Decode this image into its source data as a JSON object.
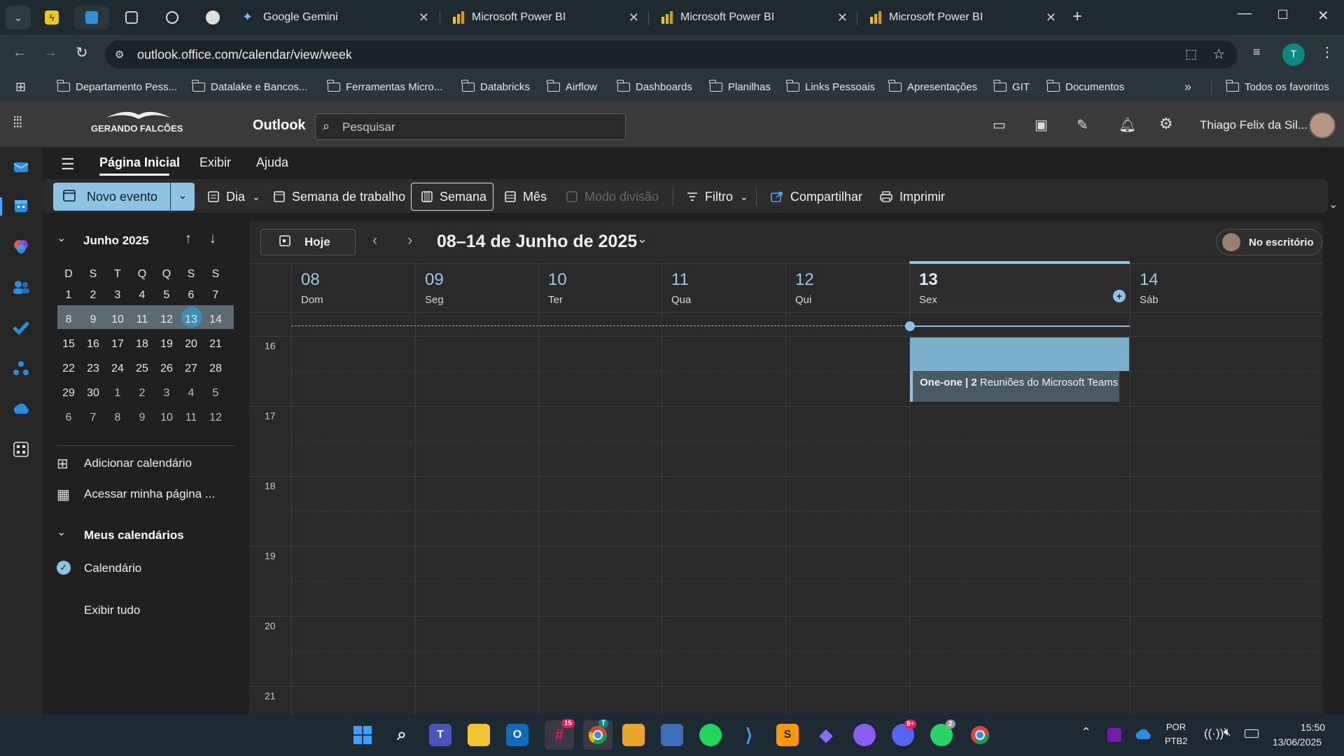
{
  "browser": {
    "tabs": [
      {
        "title": "Google Gemini",
        "icon": "gemini-icon"
      },
      {
        "title": "Microsoft Power BI",
        "icon": "powerbi-icon"
      },
      {
        "title": "Microsoft Power BI",
        "icon": "powerbi-icon"
      },
      {
        "title": "Microsoft Power BI",
        "icon": "powerbi-icon"
      }
    ],
    "url": "outlook.office.com/calendar/view/week",
    "profile_initial": "T",
    "bookmarks": [
      "Departamento Pess...",
      "Datalake e Bancos...",
      "Ferramentas Micro...",
      "Databricks",
      "Airflow",
      "Dashboards",
      "Planilhas",
      "Links Pessoais",
      "Apresentações",
      "GIT",
      "Documentos"
    ],
    "all_bookmarks": "Todos os favoritos"
  },
  "outlook": {
    "org_logo_text": "GERANDO FALCÕES",
    "app_name": "Outlook",
    "search_placeholder": "Pesquisar",
    "user_name": "Thiago Felix da Sil..."
  },
  "ribbon": {
    "tabs": [
      "Página Inicial",
      "Exibir",
      "Ajuda"
    ],
    "new_event": "Novo evento",
    "day": "Dia",
    "work_week": "Semana de trabalho",
    "week": "Semana",
    "month": "Mês",
    "split": "Modo divisão",
    "filter": "Filtro",
    "share": "Compartilhar",
    "print": "Imprimir"
  },
  "mini_calendar": {
    "month_label": "Junho 2025",
    "weekdays": [
      "D",
      "S",
      "T",
      "Q",
      "Q",
      "S",
      "S"
    ],
    "weeks": [
      [
        "1",
        "2",
        "3",
        "4",
        "5",
        "6",
        "7"
      ],
      [
        "8",
        "9",
        "10",
        "11",
        "12",
        "13",
        "14"
      ],
      [
        "15",
        "16",
        "17",
        "18",
        "19",
        "20",
        "21"
      ],
      [
        "22",
        "23",
        "24",
        "25",
        "26",
        "27",
        "28"
      ],
      [
        "29",
        "30",
        "1",
        "2",
        "3",
        "4",
        "5"
      ],
      [
        "6",
        "7",
        "8",
        "9",
        "10",
        "11",
        "12"
      ]
    ],
    "today": "13"
  },
  "sidebar": {
    "add_calendar": "Adicionar calendário",
    "my_page": "Acessar minha página ...",
    "my_calendars": "Meus calendários",
    "calendar": "Calendário",
    "show_all": "Exibir tudo"
  },
  "calendar": {
    "today_button": "Hoje",
    "range_title": "08–14 de Junho de 2025",
    "status": "No escritório",
    "days": [
      {
        "num": "08",
        "name": "Dom"
      },
      {
        "num": "09",
        "name": "Seg"
      },
      {
        "num": "10",
        "name": "Ter"
      },
      {
        "num": "11",
        "name": "Qua"
      },
      {
        "num": "12",
        "name": "Qui"
      },
      {
        "num": "13",
        "name": "Sex"
      },
      {
        "num": "14",
        "name": "Sáb"
      }
    ],
    "hours": [
      "16",
      "17",
      "18",
      "19",
      "20",
      "21"
    ],
    "event": {
      "bold": "One-one | 2",
      "rest": " Reuniões do Microsoft Teams"
    }
  },
  "taskbar": {
    "badges": {
      "slack": "15",
      "chrome_profile": "T",
      "discord": "9+",
      "whatsapp": "2"
    },
    "lang": "POR",
    "layout": "PTB2",
    "time": "15:50",
    "date": "13/06/2025"
  }
}
